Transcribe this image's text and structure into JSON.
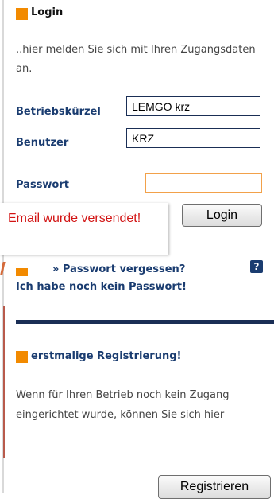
{
  "login": {
    "heading": "Login",
    "intro": "..hier melden Sie sich mit Ihren Zugangsdaten an.",
    "fields": {
      "betriebskuerzel_label": "Betriebskürzel",
      "betriebskuerzel_value": "LEMGO krz",
      "benutzer_label": "Benutzer",
      "benutzer_value": "KRZ",
      "passwort_label": "Passwort",
      "passwort_value": ""
    },
    "login_button": "Login"
  },
  "notification": {
    "message": "Email wurde versendet!"
  },
  "links": {
    "forgot_password": "» Passwort vergessen?",
    "help_glyph": "?",
    "no_password": "Ich habe noch kein Passwort!"
  },
  "registration": {
    "heading": "erstmalige Registrierung!",
    "text": "Wenn für Ihren Betrieb noch kein Zugang eingerichtet wurde, können Sie sich hier",
    "button": "Registrieren"
  },
  "colors": {
    "accent_orange": "#f28a00",
    "label_blue": "#1a3c70",
    "notification_red": "#d21414"
  },
  "icons": [
    "orange-square-icon",
    "help-icon"
  ]
}
